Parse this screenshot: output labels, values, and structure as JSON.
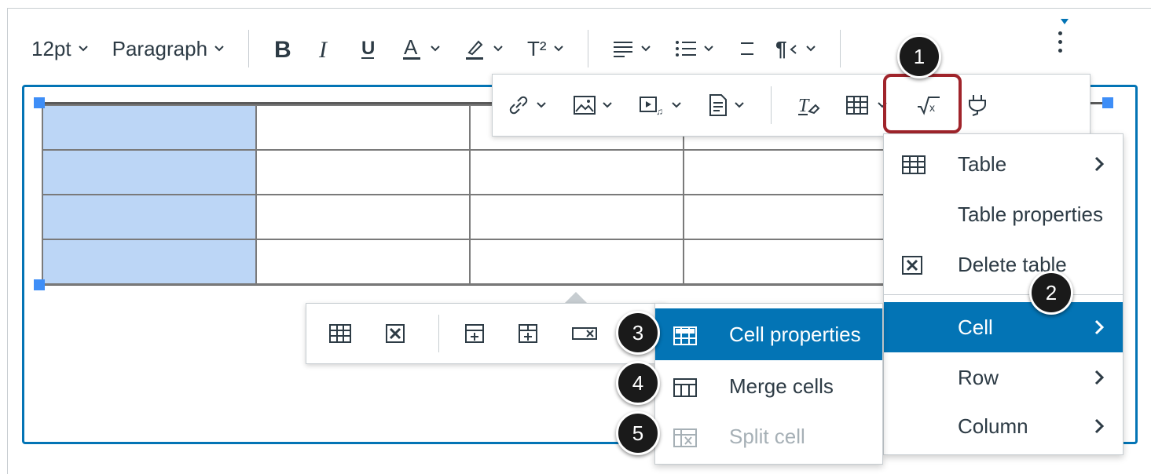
{
  "toolbar": {
    "font_size": "12pt",
    "block_format": "Paragraph",
    "superscript_label": "T²"
  },
  "table_menu": {
    "items": [
      {
        "label": "Table",
        "icon": "table-icon",
        "has_submenu": true
      },
      {
        "label": "Table properties",
        "icon": "",
        "has_submenu": false
      },
      {
        "label": "Delete table",
        "icon": "delete-table-icon",
        "has_submenu": false
      },
      {
        "label": "Cell",
        "icon": "",
        "has_submenu": true,
        "active": true
      },
      {
        "label": "Row",
        "icon": "",
        "has_submenu": true
      },
      {
        "label": "Column",
        "icon": "",
        "has_submenu": true
      }
    ]
  },
  "cell_submenu": {
    "items": [
      {
        "label": "Cell properties",
        "icon": "cell-properties-icon",
        "active": true
      },
      {
        "label": "Merge cells",
        "icon": "merge-cells-icon"
      },
      {
        "label": "Split cell",
        "icon": "split-cell-icon",
        "disabled": true
      }
    ]
  },
  "callouts": [
    "1",
    "2",
    "3",
    "4",
    "5"
  ],
  "colors": {
    "accent": "#0374b5",
    "highlight_outline": "#a0242b",
    "selected_cell": "#bcd6f6",
    "text": "#2d3b45"
  }
}
